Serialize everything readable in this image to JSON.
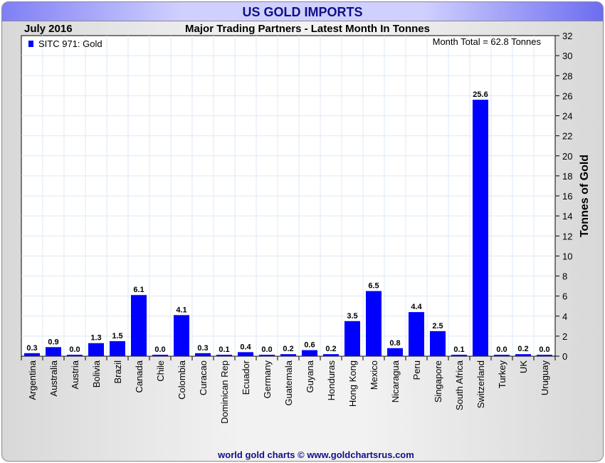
{
  "chart_data": {
    "type": "bar",
    "title": "US GOLD IMPORTS",
    "date_label": "July 2016",
    "subtitle": "Major Trading Partners - Latest Month In Tonnes",
    "legend": "SITC 971: Gold",
    "legend_placement": "top-left",
    "annotation": "Month Total = 62.8 Tonnes",
    "ylabel": "Tonnes of Gold",
    "xlabel": "",
    "ylim": [
      0,
      32
    ],
    "ytick_step": 2,
    "grid": true,
    "bar_color": "#0000ff",
    "categories": [
      "Argentina",
      "Australia",
      "Austria",
      "Bolivia",
      "Brazil",
      "Canada",
      "Chile",
      "Colombia",
      "Curacao",
      "Dominican Rep",
      "Ecuador",
      "Germany",
      "Guatemala",
      "Guyana",
      "Honduras",
      "Hong Kong",
      "Mexico",
      "Nicaragua",
      "Peru",
      "Singapore",
      "South Africa",
      "Switzerland",
      "Turkey",
      "UK",
      "Uruguay"
    ],
    "values": [
      0.3,
      0.9,
      0.0,
      1.3,
      1.5,
      6.1,
      0.0,
      4.1,
      0.3,
      0.1,
      0.4,
      0.0,
      0.2,
      0.6,
      0.2,
      3.5,
      6.5,
      0.8,
      4.4,
      2.5,
      0.1,
      25.6,
      0.0,
      0.2,
      0.0
    ]
  },
  "footer": "world gold charts © www.goldchartsrus.com"
}
